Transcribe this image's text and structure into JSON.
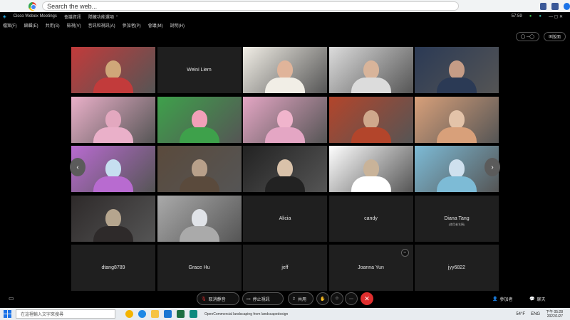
{
  "browser": {
    "address": "Search the web..."
  },
  "app": {
    "title": "Cisco Webex Meetings",
    "tab_meeting": "會議資訊",
    "tab_connected": "隱藏功能選項 ⌃",
    "clock": "57:59"
  },
  "menu": [
    "檔案(F)",
    "編輯(E)",
    "共用(S)",
    "檢視(V)",
    "音訊和視訊(A)",
    "參加者(P)",
    "會議(M)",
    "說明(H)"
  ],
  "top_controls": {
    "layout": "版面",
    "speaker_toggle": ""
  },
  "tiles": [
    {
      "name": "",
      "type": "video",
      "colors": [
        "#cfa779",
        "#c23b3b"
      ]
    },
    {
      "name": "Weini Liem",
      "type": "name"
    },
    {
      "name": "",
      "type": "video",
      "colors": [
        "#e0b49a",
        "#f1eee6"
      ]
    },
    {
      "name": "",
      "type": "video",
      "colors": [
        "#d8b49a",
        "#dcdcdc"
      ]
    },
    {
      "name": "",
      "type": "video",
      "colors": [
        "#c59c86",
        "#2b3a55"
      ]
    },
    {
      "name": "",
      "type": "video",
      "colors": [
        "#e3a8bf",
        "#eab0c9"
      ]
    },
    {
      "name": "",
      "type": "video",
      "colors": [
        "#f1a0b8",
        "#3ea14b"
      ]
    },
    {
      "name": "",
      "type": "video",
      "colors": [
        "#f0b4cc",
        "#e4a6c4"
      ]
    },
    {
      "name": "",
      "type": "video",
      "colors": [
        "#cfa88c",
        "#b3452b"
      ]
    },
    {
      "name": "",
      "type": "video",
      "colors": [
        "#e3c3a9",
        "#d8a07a"
      ]
    },
    {
      "name": "",
      "type": "video",
      "colors": [
        "#c6dff0",
        "#b86bd0"
      ]
    },
    {
      "name": "",
      "type": "video",
      "colors": [
        "#b8a08a",
        "#5a4a3c"
      ]
    },
    {
      "name": "",
      "type": "video",
      "colors": [
        "#d9c2aa",
        "#222222"
      ]
    },
    {
      "name": "",
      "type": "video",
      "colors": [
        "#c9b399",
        "#ffffff"
      ]
    },
    {
      "name": "",
      "type": "video",
      "colors": [
        "#cfe0ee",
        "#7dbbd6"
      ]
    },
    {
      "name": "",
      "type": "video",
      "colors": [
        "#b5a58e",
        "#2e2a2a"
      ]
    },
    {
      "name": "",
      "type": "video",
      "colors": [
        "#e0e3e8",
        "#aaaaaa"
      ]
    },
    {
      "name": "Alicia",
      "type": "name"
    },
    {
      "name": "candy",
      "type": "name"
    },
    {
      "name": "Diana Tang",
      "type": "name",
      "sub": "(使用者名稱)"
    },
    {
      "name": "dtang8789",
      "type": "name"
    },
    {
      "name": "Grace Hu",
      "type": "name"
    },
    {
      "name": "jeff",
      "type": "name"
    },
    {
      "name": "Joanna Yun",
      "type": "name",
      "muted": true
    },
    {
      "name": "jyy6822",
      "type": "name"
    }
  ],
  "controls": {
    "mute": "取消靜音",
    "video": "停止視訊",
    "share": "共用",
    "participants": "參加者",
    "chat": "聊天"
  },
  "taskbar": {
    "search": "在這裡輸入文字來搜尋",
    "tab1": "OpenCommercial landscaping from landscapedesign",
    "weather": "54°F",
    "lang": "ENG",
    "time": "下午 05:28",
    "date": "2022/1/27"
  }
}
